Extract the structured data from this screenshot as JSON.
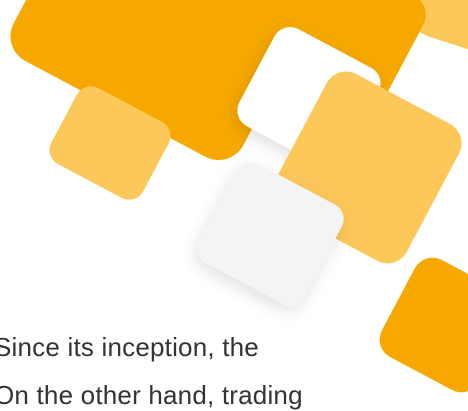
{
  "colors": {
    "orange": "#F6A800",
    "light_orange": "#FDC85A",
    "shadow": "#E6E6E6",
    "white": "#FFFFFF",
    "text": "#333333"
  },
  "decoration": {
    "description_icon": "abstract-rounded-squares-graphic"
  },
  "body": {
    "line_1": "Since its inception, the",
    "line_2": "On the other hand, trading"
  }
}
